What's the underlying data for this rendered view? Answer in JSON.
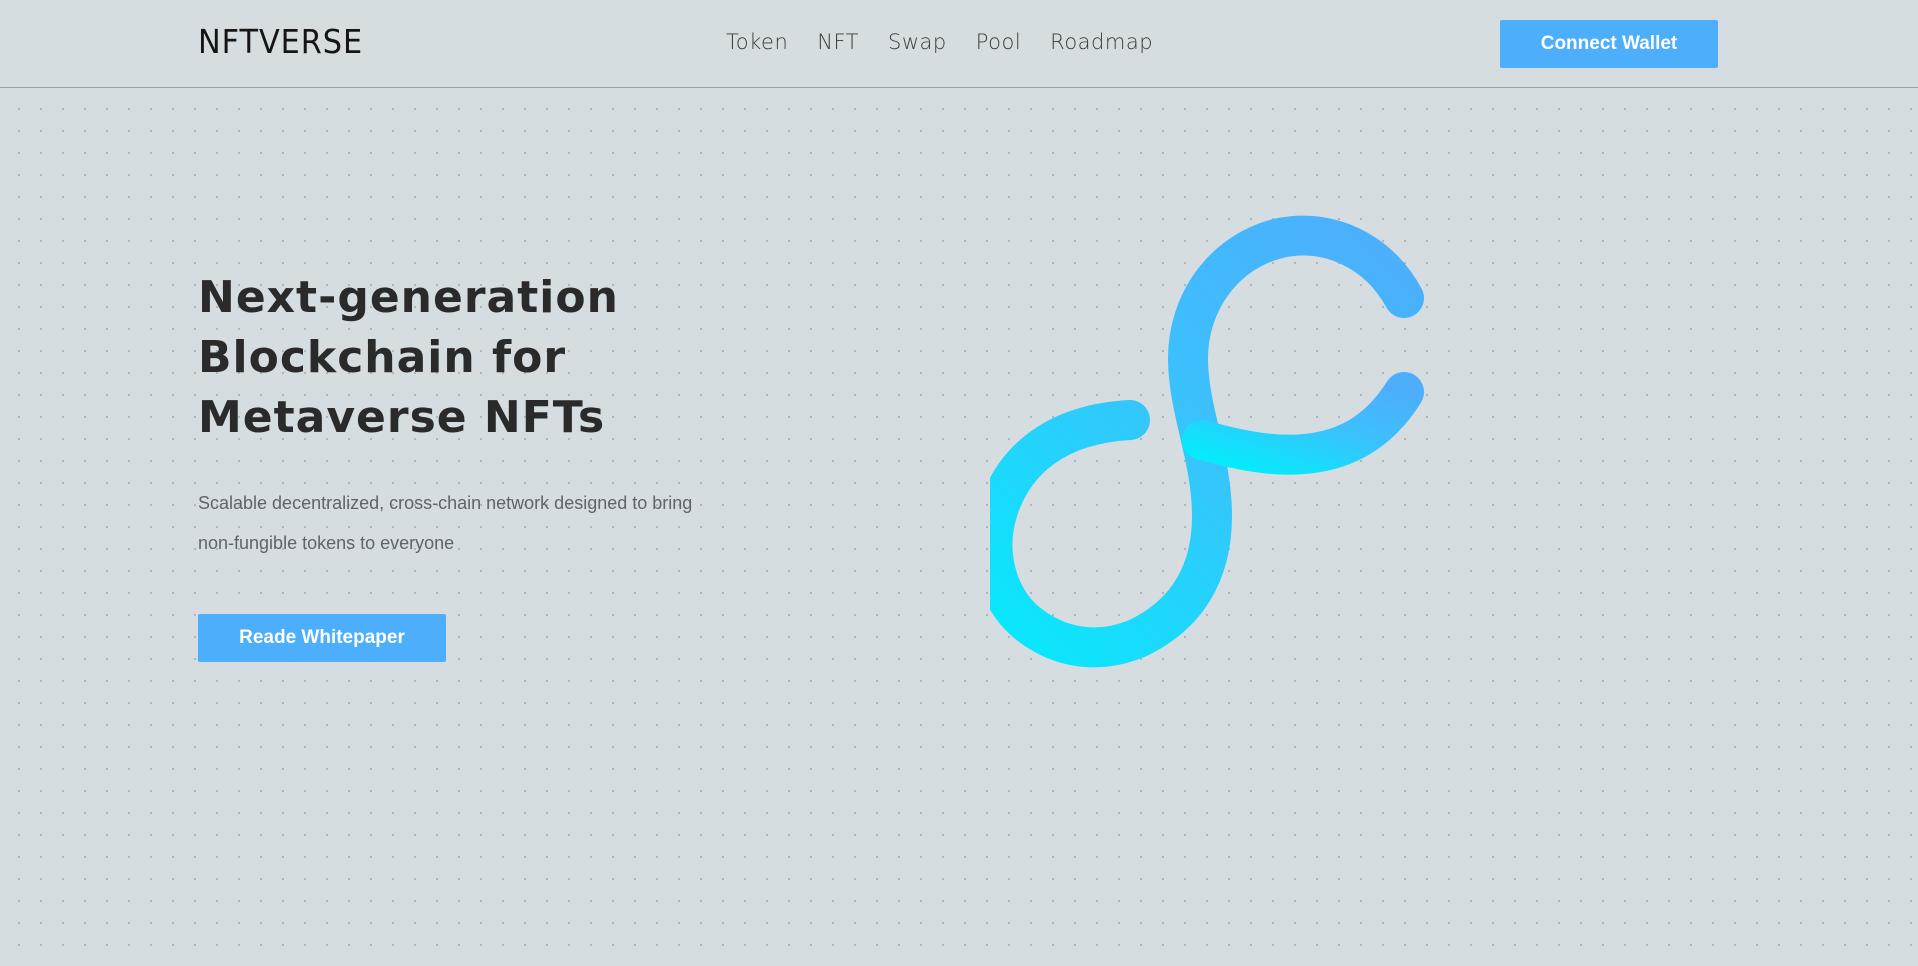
{
  "header": {
    "logo": "NFTVERSE",
    "nav": [
      "Token",
      "NFT",
      "Swap",
      "Pool",
      "Roadmap"
    ],
    "connect_wallet": "Connect Wallet"
  },
  "hero": {
    "title_lines": [
      "Next-generation",
      "Blockchain for",
      "Metaverse NFTs"
    ],
    "description_lines": [
      "Scalable decentralized, cross-chain network designed to bring",
      "non-fungible tokens to everyone"
    ],
    "cta": "Reade Whitepaper"
  },
  "colors": {
    "accent": "#4daefc",
    "background": "#d5dde1",
    "gradient_start": "#06eafc",
    "gradient_end": "#4daefc"
  },
  "icons": {
    "hero_graphic": "infinity-loop-logo"
  }
}
